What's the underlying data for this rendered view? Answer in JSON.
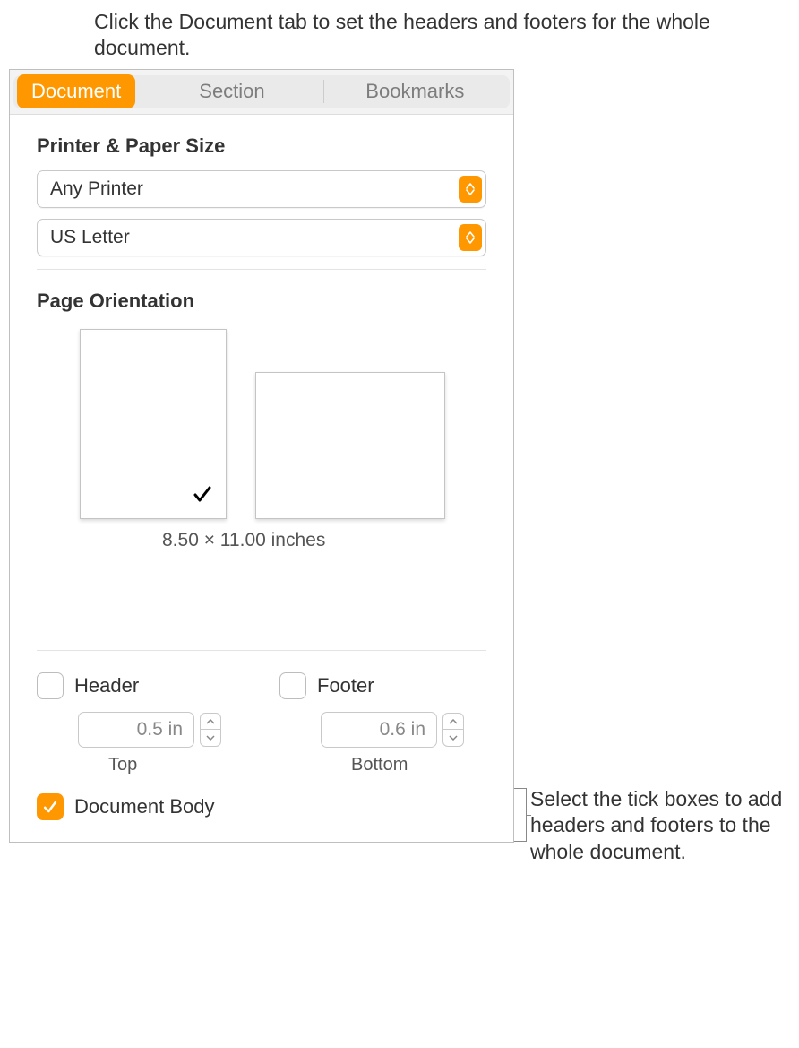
{
  "callouts": {
    "top": "Click the Document tab to set the headers and footers for the whole document.",
    "right": "Select the tick boxes to add headers and footers to the whole document."
  },
  "tabs": {
    "document": "Document",
    "section": "Section",
    "bookmarks": "Bookmarks"
  },
  "printer_section": {
    "title": "Printer & Paper Size",
    "printer": "Any Printer",
    "paper": "US Letter"
  },
  "orientation_section": {
    "title": "Page Orientation",
    "dimensions": "8.50 × 11.00 inches"
  },
  "hf": {
    "header_label": "Header",
    "footer_label": "Footer",
    "header_value": "0.5 in",
    "footer_value": "0.6 in",
    "top_label": "Top",
    "bottom_label": "Bottom"
  },
  "doc_body_label": "Document Body"
}
